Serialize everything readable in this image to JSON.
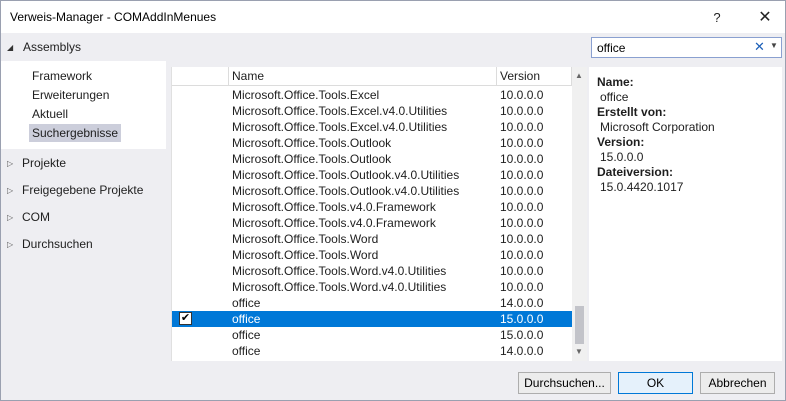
{
  "window": {
    "title": "Verweis-Manager - COMAddInMenues",
    "help": "?",
    "close": "✕"
  },
  "left": {
    "assemblys": "Assemblys",
    "sub_items": [
      {
        "label": "Framework",
        "selected": false
      },
      {
        "label": "Erweiterungen",
        "selected": false
      },
      {
        "label": "Aktuell",
        "selected": false
      },
      {
        "label": "Suchergebnisse",
        "selected": true
      }
    ],
    "categories": [
      {
        "label": "Projekte"
      },
      {
        "label": "Freigegebene Projekte"
      },
      {
        "label": "COM"
      },
      {
        "label": "Durchsuchen"
      }
    ]
  },
  "search": {
    "value": "office",
    "clear": "✕",
    "dropdown": "▼"
  },
  "grid": {
    "col_name": "Name",
    "col_version": "Version",
    "rows": [
      {
        "name": "Microsoft.Office.Tools.Excel",
        "version": "10.0.0.0",
        "checked": false,
        "selected": false
      },
      {
        "name": "Microsoft.Office.Tools.Excel.v4.0.Utilities",
        "version": "10.0.0.0",
        "checked": false,
        "selected": false
      },
      {
        "name": "Microsoft.Office.Tools.Excel.v4.0.Utilities",
        "version": "10.0.0.0",
        "checked": false,
        "selected": false
      },
      {
        "name": "Microsoft.Office.Tools.Outlook",
        "version": "10.0.0.0",
        "checked": false,
        "selected": false
      },
      {
        "name": "Microsoft.Office.Tools.Outlook",
        "version": "10.0.0.0",
        "checked": false,
        "selected": false
      },
      {
        "name": "Microsoft.Office.Tools.Outlook.v4.0.Utilities",
        "version": "10.0.0.0",
        "checked": false,
        "selected": false
      },
      {
        "name": "Microsoft.Office.Tools.Outlook.v4.0.Utilities",
        "version": "10.0.0.0",
        "checked": false,
        "selected": false
      },
      {
        "name": "Microsoft.Office.Tools.v4.0.Framework",
        "version": "10.0.0.0",
        "checked": false,
        "selected": false
      },
      {
        "name": "Microsoft.Office.Tools.v4.0.Framework",
        "version": "10.0.0.0",
        "checked": false,
        "selected": false
      },
      {
        "name": "Microsoft.Office.Tools.Word",
        "version": "10.0.0.0",
        "checked": false,
        "selected": false
      },
      {
        "name": "Microsoft.Office.Tools.Word",
        "version": "10.0.0.0",
        "checked": false,
        "selected": false
      },
      {
        "name": "Microsoft.Office.Tools.Word.v4.0.Utilities",
        "version": "10.0.0.0",
        "checked": false,
        "selected": false
      },
      {
        "name": "Microsoft.Office.Tools.Word.v4.0.Utilities",
        "version": "10.0.0.0",
        "checked": false,
        "selected": false
      },
      {
        "name": "office",
        "version": "14.0.0.0",
        "checked": false,
        "selected": false
      },
      {
        "name": "office",
        "version": "15.0.0.0",
        "checked": true,
        "selected": true
      },
      {
        "name": "office",
        "version": "15.0.0.0",
        "checked": false,
        "selected": false
      },
      {
        "name": "office",
        "version": "14.0.0.0",
        "checked": false,
        "selected": false
      }
    ]
  },
  "details": {
    "name_label": "Name:",
    "name_value": "office",
    "creator_label": "Erstellt von:",
    "creator_value": "Microsoft Corporation",
    "version_label": "Version:",
    "version_value": "15.0.0.0",
    "fileversion_label": "Dateiversion:",
    "fileversion_value": "15.0.4420.1017"
  },
  "buttons": {
    "browse": "Durchsuchen...",
    "ok": "OK",
    "cancel": "Abbrechen"
  }
}
